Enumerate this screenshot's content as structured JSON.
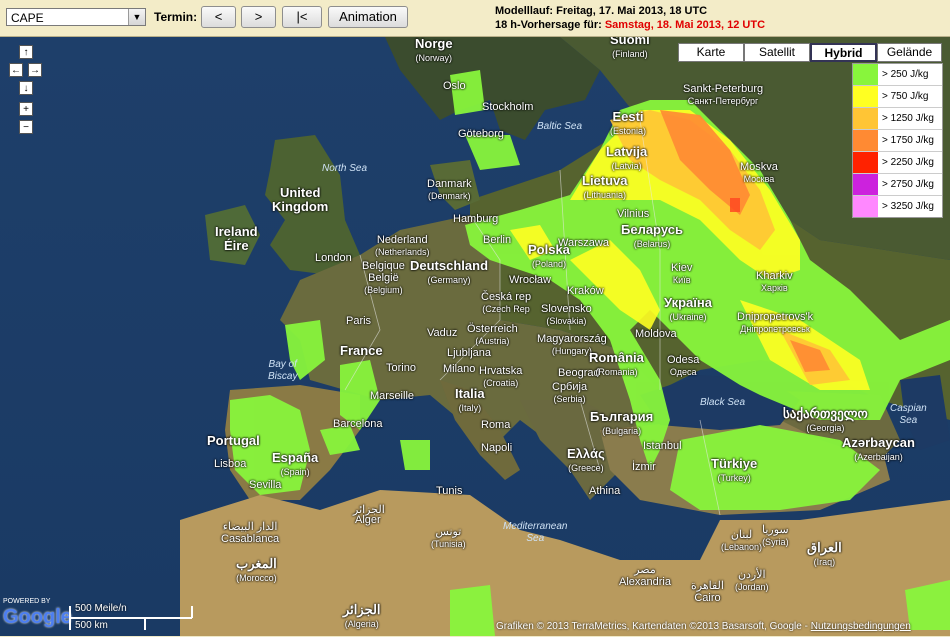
{
  "controls": {
    "product_value": "CAPE",
    "termin_label": "Termin:",
    "prev_label": "<",
    "next_label": ">",
    "first_label": "|<",
    "animation_label": "Animation"
  },
  "run_info": {
    "model_run": "Modelllauf: Freitag, 17. Mai 2013, 18 UTC",
    "forecast_prefix": "18 h-Vorhersage für:",
    "forecast_date": "Samstag, 18. Mai 2013, 12 UTC"
  },
  "map_types": [
    "Karte",
    "Satellit",
    "Hybrid",
    "Gelände"
  ],
  "active_map_type": "Hybrid",
  "legend": [
    {
      "label": "> 250 J/kg",
      "color": "#88f53c"
    },
    {
      "label": "> 750 J/kg",
      "color": "#ffff22"
    },
    {
      "label": "> 1250 J/kg",
      "color": "#ffc535"
    },
    {
      "label": "> 1750 J/kg",
      "color": "#ff8a33"
    },
    {
      "label": "> 2250 J/kg",
      "color": "#ff2200"
    },
    {
      "label": "> 2750 J/kg",
      "color": "#cc22dd"
    },
    {
      "label": "> 3250 J/kg",
      "color": "#ff88ff"
    }
  ],
  "labels": {
    "norge": "Norge",
    "norway": "(Norway)",
    "suomi": "Suomi",
    "finland": "(Finland)",
    "oslo": "Oslo",
    "stockholm": "Stockholm",
    "goteborg": "Göteborg",
    "sankt_peterburg": "Sankt-Peterburg",
    "sankt_cyr": "Санкт-Петербург",
    "eesti": "Eesti",
    "estonia": "(Estonia)",
    "latvija": "Latvija",
    "latvia": "(Latvia)",
    "lietuva": "Lietuva",
    "lithuania": "(Lithuania)",
    "vilnius": "Vilnius",
    "baltic_sea": "Baltic Sea",
    "north_sea": "North Sea",
    "danmark": "Danmark",
    "denmark": "(Denmark)",
    "moskva": "Moskva",
    "moskva_cyr": "Москва",
    "united_kingdom": "United\nKingdom",
    "ireland": "Ireland",
    "eire": "Éire",
    "london": "London",
    "hamburg": "Hamburg",
    "berlin": "Berlin",
    "nederland": "Nederland",
    "netherlands": "(Netherlands)",
    "belgique": "Belgique",
    "belgie": "België",
    "belgium": "(Belgium)",
    "deutschland": "Deutschland",
    "germany": "(Germany)",
    "polska": "Polska",
    "poland": "(Poland)",
    "belarus_cyr": "Беларусь",
    "belarus": "(Belarus)",
    "warszawa": "Warszawa",
    "wroclaw": "Wrocław",
    "krakow": "Kraków",
    "ceska": "Česká rep",
    "czech": "(Czech Rep",
    "kiev": "Kiev",
    "kiev_cyr": "Київ",
    "kharkiv": "Kharkiv",
    "kharkiv_cyr": "Харків",
    "paris": "Paris",
    "ukraina_cyr": "Україна",
    "ukraine": "(Ukraine)",
    "slovensko": "Slovensko",
    "slovakia": "(Slovakia)",
    "osterreich": "Österreich",
    "austria": "(Austria)",
    "vaduz": "Vaduz",
    "magyarorszag": "Magyarország",
    "hungary": "(Hungary)",
    "dnipro": "Dnipropetrovs'k",
    "dnipro_cyr": "Дніпропетровськ",
    "moldova": "Moldova",
    "france": "France",
    "ljubljana": "Ljubljana",
    "beograd": "Beograd",
    "romania": "România",
    "romania_en": "(Romania)",
    "odesa": "Odesa",
    "odesa_cyr": "Одеса",
    "bay_of_biscay": "Bay of\nBiscay",
    "torino": "Torino",
    "milano": "Milano",
    "hrvatska": "Hrvatska",
    "croatia": "(Croatia)",
    "srbija": "Србија",
    "serbia": "(Serbia)",
    "marseille": "Marseille",
    "italia": "Italia",
    "italy": "(Italy)",
    "bulgaria_cyr": "България",
    "bulgaria": "(Bulgaria)",
    "black_sea": "Black Sea",
    "sakartvelo": "საქართველო",
    "georgia": "(Georgia)",
    "caspian": "Caspian\nSea",
    "barcelona": "Barcelona",
    "roma": "Roma",
    "portugal": "Portugal",
    "espana": "España",
    "spain": "(Spain)",
    "istanbul": "Istanbul",
    "napoli": "Napoli",
    "ellas": "Ελλάς",
    "greece": "(Greece)",
    "azerbaycan": "Azərbaycan",
    "azerbaijan": "(Azerbaijan)",
    "lisboa": "Lisboa",
    "izmir": "İzmir",
    "turkiye": "Türkiye",
    "turkey": "(Turkey)",
    "tunis": "Tunis",
    "sevilla": "Sevilla",
    "athina": "Athina",
    "tunisia_ar": "تونس",
    "tunisia": "(Tunisia)",
    "alger": "Alger",
    "dar_beida": "الدار البيضاء",
    "casablanca": "Casablanca",
    "mediterranean": "Mediterranean\nSea",
    "syria_ar": "سوريا",
    "syria": "(Syria)",
    "lebanon_ar": "لبنان",
    "lebanon": "(Lebanon)",
    "iraq_ar": "العراق",
    "iraq": "(Iraq)",
    "maghrib": "المغرب",
    "morocco": "(Morocco)",
    "misr": "مصر",
    "alexandria": "Alexandria",
    "jordan_ar": "الأردن",
    "jordan": "(Jordan)",
    "cairo_ar": "القاهرة",
    "cairo": "Cairo",
    "algeria_ar": "الجزائر",
    "algeria": "(Algeria)"
  },
  "scale": {
    "miles": "500 Meile/n",
    "km": "500 km"
  },
  "google": {
    "powered": "POWERED BY",
    "logo": "Google"
  },
  "credit_prefix": "Grafiken © 2013 TerraMetrics, Kartendaten ©2013 Basarsoft, Google -",
  "credit_link": "Nutzungsbedingungen"
}
